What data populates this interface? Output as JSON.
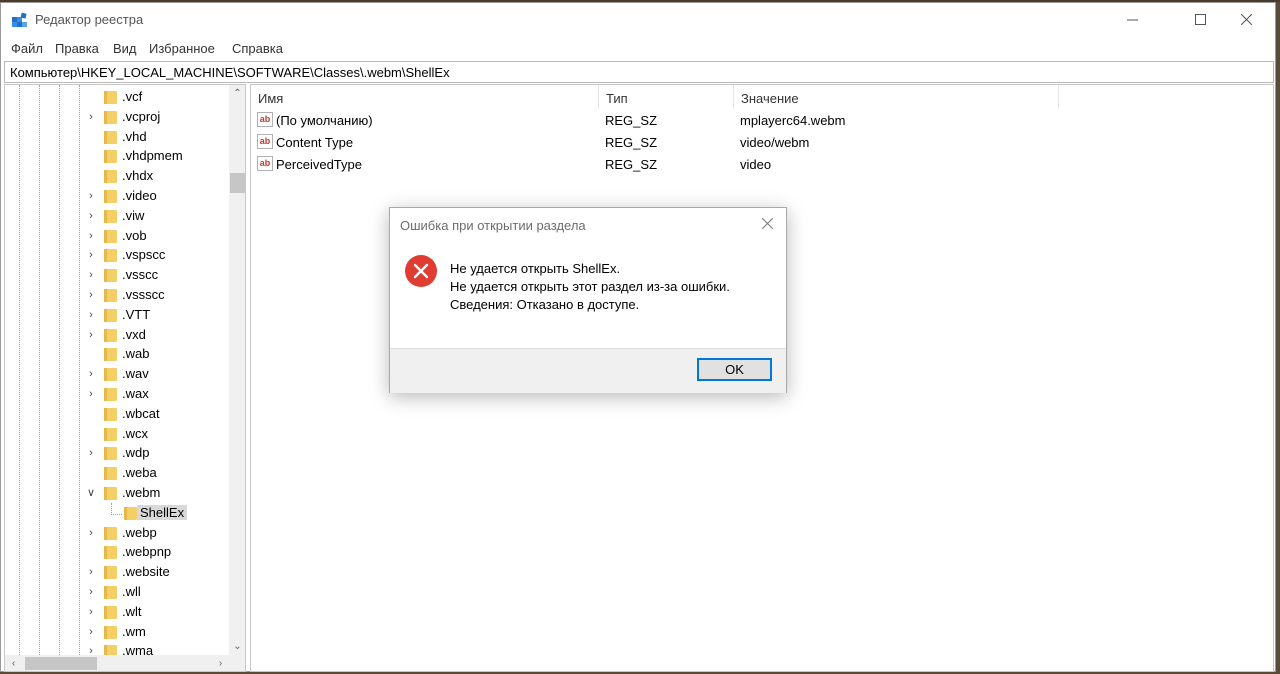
{
  "window": {
    "title": "Редактор реестра"
  },
  "menu": [
    "Файл",
    "Правка",
    "Вид",
    "Избранное",
    "Справка"
  ],
  "address": "Компьютер\\HKEY_LOCAL_MACHINE\\SOFTWARE\\Classes\\.webm\\ShellEx",
  "tree": {
    "items": [
      {
        "label": ".vcf",
        "expander": "none"
      },
      {
        "label": ".vcproj",
        "expander": "collapsed"
      },
      {
        "label": ".vhd",
        "expander": "none"
      },
      {
        "label": ".vhdpmem",
        "expander": "none"
      },
      {
        "label": ".vhdx",
        "expander": "none"
      },
      {
        "label": ".video",
        "expander": "collapsed"
      },
      {
        "label": ".viw",
        "expander": "collapsed"
      },
      {
        "label": ".vob",
        "expander": "collapsed"
      },
      {
        "label": ".vspscc",
        "expander": "collapsed"
      },
      {
        "label": ".vsscc",
        "expander": "collapsed"
      },
      {
        "label": ".vssscc",
        "expander": "collapsed"
      },
      {
        "label": ".VTT",
        "expander": "collapsed"
      },
      {
        "label": ".vxd",
        "expander": "collapsed"
      },
      {
        "label": ".wab",
        "expander": "none"
      },
      {
        "label": ".wav",
        "expander": "collapsed"
      },
      {
        "label": ".wax",
        "expander": "collapsed"
      },
      {
        "label": ".wbcat",
        "expander": "none"
      },
      {
        "label": ".wcx",
        "expander": "none"
      },
      {
        "label": ".wdp",
        "expander": "collapsed"
      },
      {
        "label": ".weba",
        "expander": "none"
      },
      {
        "label": ".webm",
        "expander": "expanded"
      },
      {
        "label": "ShellEx",
        "expander": "child",
        "selected": true
      },
      {
        "label": ".webp",
        "expander": "collapsed"
      },
      {
        "label": ".webpnp",
        "expander": "none"
      },
      {
        "label": ".website",
        "expander": "collapsed"
      },
      {
        "label": ".wll",
        "expander": "collapsed"
      },
      {
        "label": ".wlt",
        "expander": "collapsed"
      },
      {
        "label": ".wm",
        "expander": "collapsed"
      },
      {
        "label": ".wma",
        "expander": "collapsed"
      }
    ]
  },
  "values": {
    "columns": [
      "Имя",
      "Тип",
      "Значение"
    ],
    "rows": [
      {
        "icon": "ab",
        "name": "(По умолчанию)",
        "type": "REG_SZ",
        "data": "mplayerc64.webm"
      },
      {
        "icon": "ab",
        "name": "Content Type",
        "type": "REG_SZ",
        "data": "video/webm"
      },
      {
        "icon": "ab",
        "name": "PerceivedType",
        "type": "REG_SZ",
        "data": "video"
      }
    ]
  },
  "dialog": {
    "title": "Ошибка при открытии раздела",
    "line1": "Не удается открыть ShellEx.",
    "line2": "Не удается открыть этот раздел из-за ошибки.",
    "line3": "Сведения: Отказано в доступе.",
    "ok": "OK",
    "icon": "error-icon"
  },
  "colors": {
    "error": "#e03c31",
    "button_border": "#0078d7",
    "folder": "#f3cf66",
    "selection": "#d9d9d9"
  }
}
